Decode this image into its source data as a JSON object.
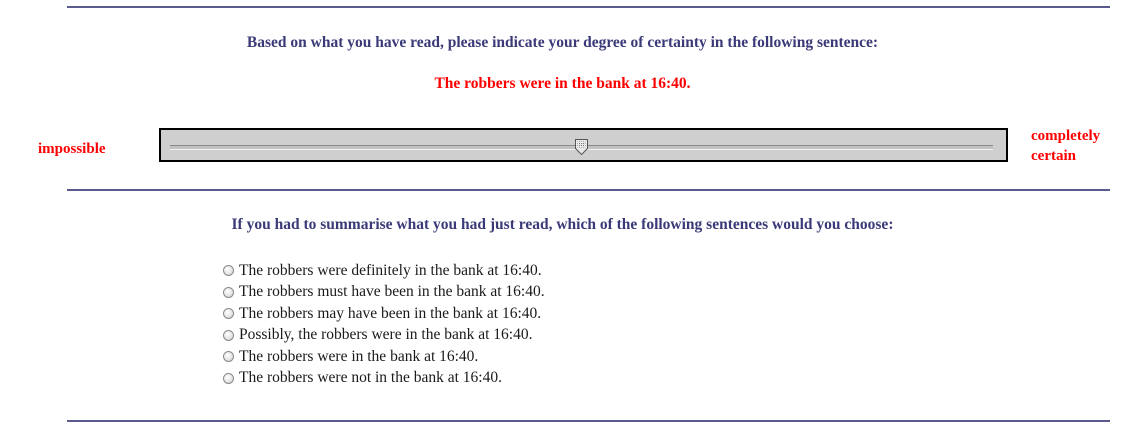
{
  "question1": {
    "prompt": "Based on what you have read, please indicate your degree of certainty in the following sentence:",
    "statement": "The robbers were in the bank at 16:40."
  },
  "slider": {
    "left_label": "impossible",
    "right_label_line1": "completely",
    "right_label_line2": "certain",
    "value_fraction": 0.5
  },
  "question2": {
    "prompt": "If you had to summarise what you had just read, which of the following sentences would you choose:",
    "options": [
      "The robbers were definitely in the bank at 16:40.",
      "The robbers must have been in the bank at 16:40.",
      "The robbers may have been in the bank at 16:40.",
      "Possibly, the robbers were in the bank at 16:40.",
      "The robbers were in the bank at 16:40.",
      "The robbers were not in the bank at 16:40."
    ]
  },
  "colors": {
    "rule": "#5a5a8c",
    "question_text": "#3a3a78",
    "emphasis_text": "#ff0000"
  }
}
